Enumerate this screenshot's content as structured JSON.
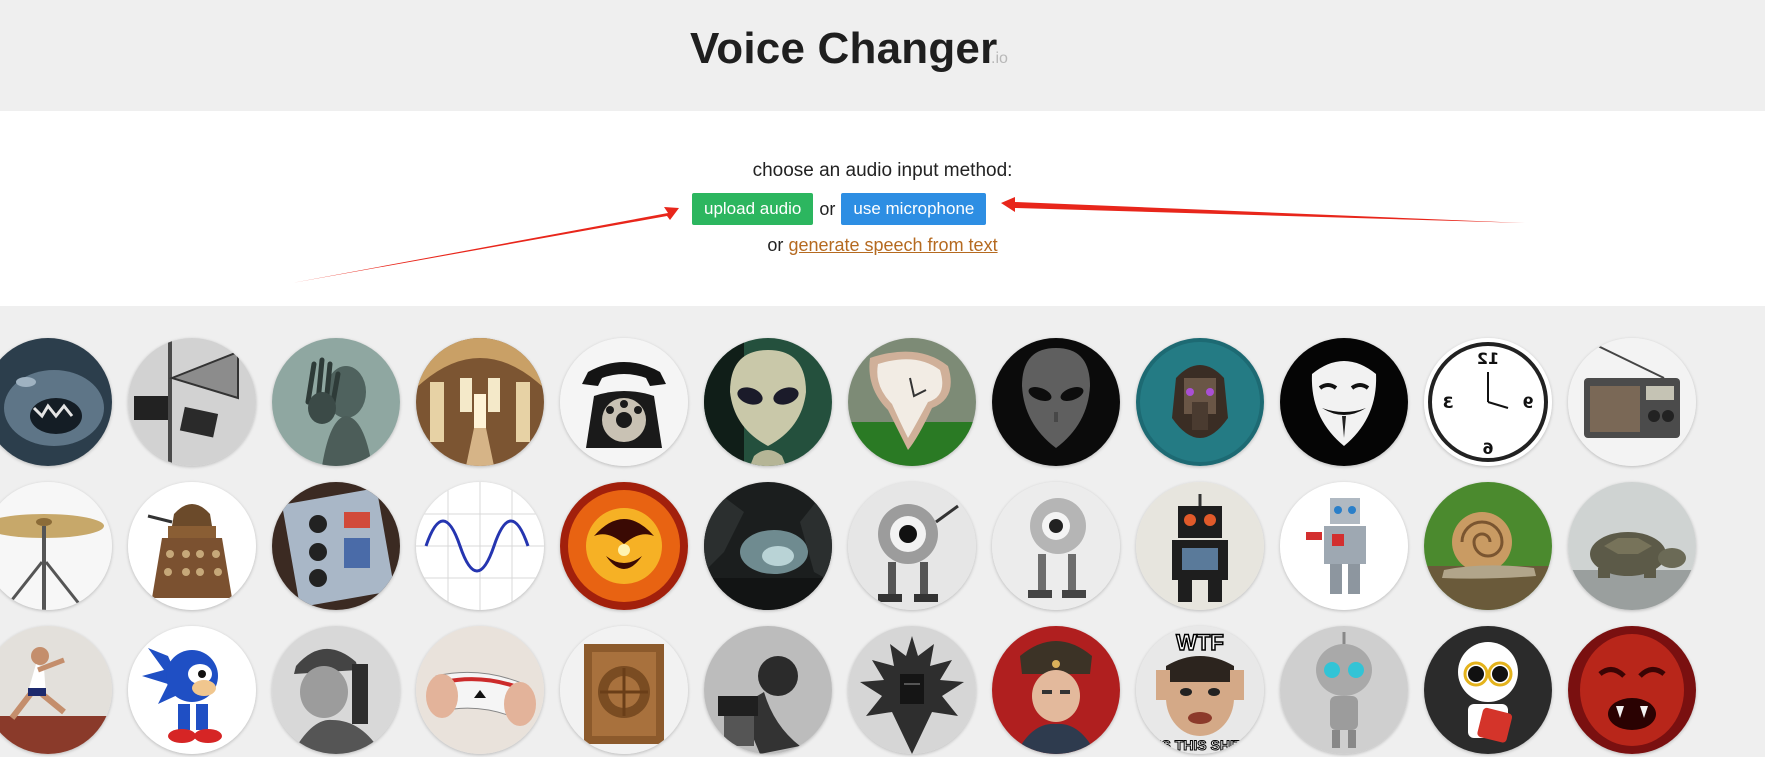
{
  "header": {
    "title": "Voice Changer",
    "suffix": ".io"
  },
  "input_panel": {
    "prompt": "choose an audio input method:",
    "upload_button": "upload audio",
    "or_text": "or",
    "mic_button": "use microphone",
    "or_prefix": "or",
    "generate_link": "generate speech from text"
  },
  "voices": [
    {
      "name": "voice-monster-roar-icon"
    },
    {
      "name": "voice-megaphone-icon"
    },
    {
      "name": "voice-ghost-icon"
    },
    {
      "name": "voice-cathedral-icon"
    },
    {
      "name": "voice-telephone-icon"
    },
    {
      "name": "voice-alien-icon"
    },
    {
      "name": "voice-melting-clock-icon"
    },
    {
      "name": "voice-grey-alien-icon"
    },
    {
      "name": "voice-cyborg-icon"
    },
    {
      "name": "voice-anonymous-mask-icon"
    },
    {
      "name": "voice-reversed-clock-icon"
    },
    {
      "name": "voice-radio-icon"
    },
    {
      "name": "voice-cymbal-icon"
    },
    {
      "name": "voice-dalek-icon"
    },
    {
      "name": "voice-synth-pedal-icon"
    },
    {
      "name": "voice-sine-wave-icon"
    },
    {
      "name": "voice-fire-demon-icon"
    },
    {
      "name": "voice-cave-icon"
    },
    {
      "name": "voice-robot-eye-icon"
    },
    {
      "name": "voice-robot-eye-2-icon"
    },
    {
      "name": "voice-toy-robot-icon"
    },
    {
      "name": "voice-lego-robot-icon"
    },
    {
      "name": "voice-snail-icon"
    },
    {
      "name": "voice-turtle-icon"
    },
    {
      "name": "voice-sprinter-icon"
    },
    {
      "name": "voice-sonic-icon"
    },
    {
      "name": "voice-soldier-radio-icon"
    },
    {
      "name": "voice-playing-cards-icon"
    },
    {
      "name": "voice-old-radio-icon"
    },
    {
      "name": "voice-old-phonograph-icon"
    },
    {
      "name": "voice-dark-lord-icon"
    },
    {
      "name": "voice-soviet-soldier-icon"
    },
    {
      "name": "voice-meme-face-icon"
    },
    {
      "name": "voice-gir-robot-icon"
    },
    {
      "name": "voice-kirobo-robot-icon"
    },
    {
      "name": "voice-red-demon-icon"
    }
  ],
  "meme_text": {
    "top": "WTF",
    "bottom": "IS THIS SHIT"
  },
  "colors": {
    "upload": "#2cb65f",
    "microphone": "#2d8ee3",
    "link": "#b56a20",
    "annotation_arrow": "#e8261b"
  }
}
